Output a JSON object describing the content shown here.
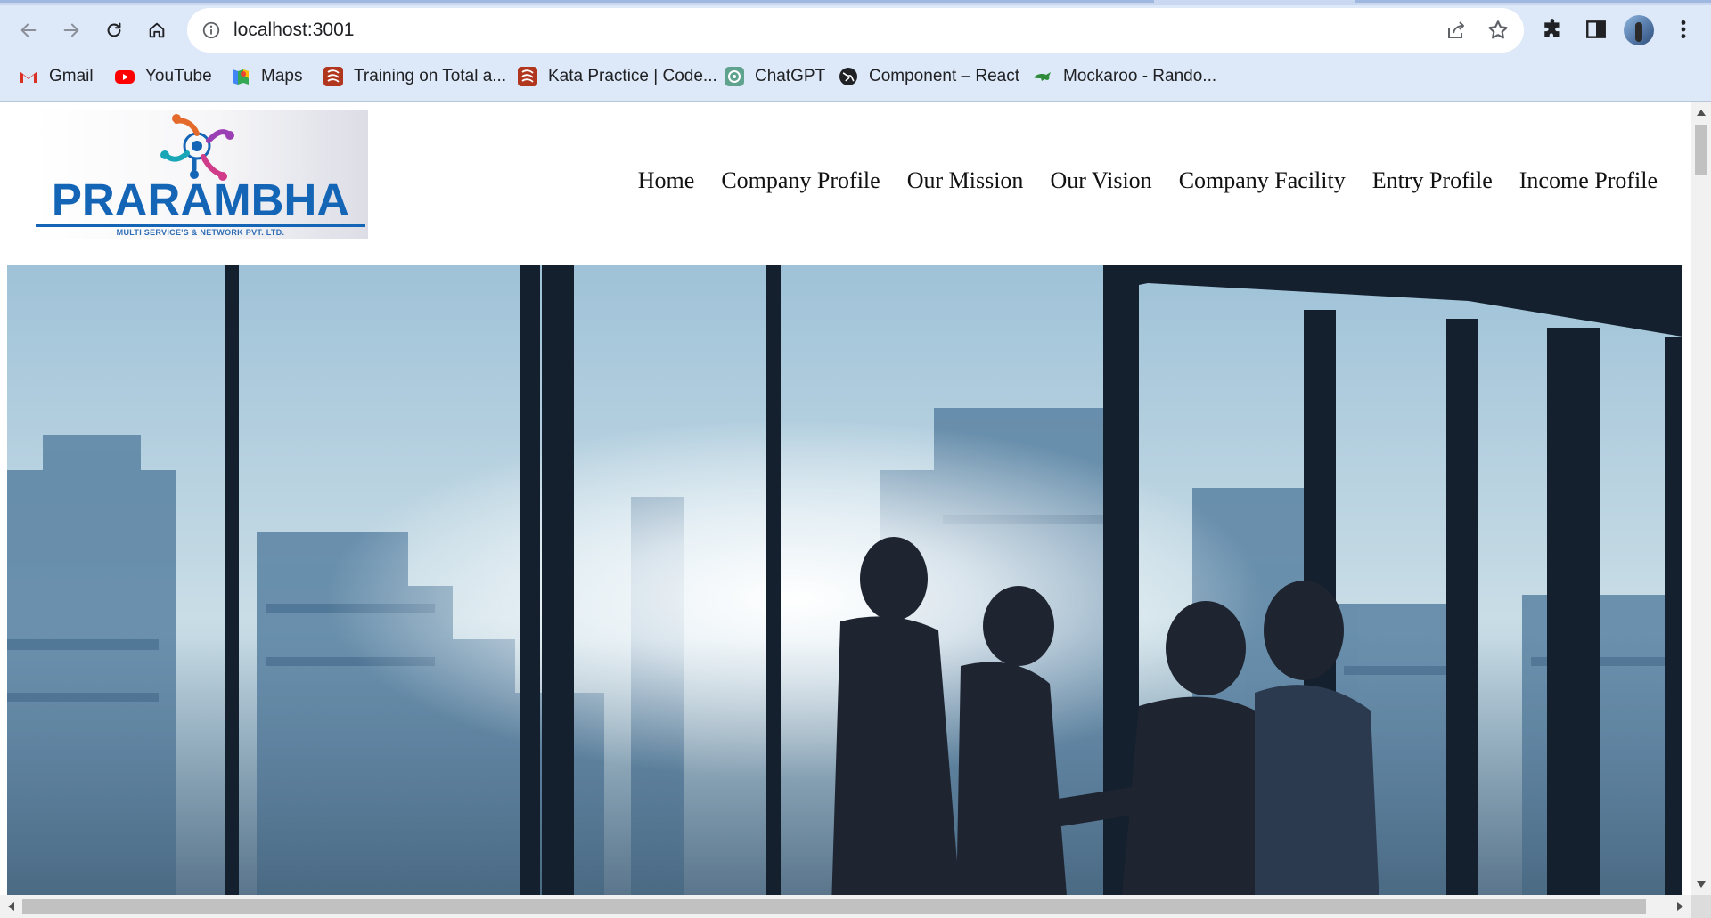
{
  "browser": {
    "url": "localhost:3001",
    "bookmarks": [
      {
        "label": "Gmail",
        "icon": "gmail-icon"
      },
      {
        "label": "YouTube",
        "icon": "youtube-icon"
      },
      {
        "label": "Maps",
        "icon": "maps-icon"
      },
      {
        "label": "Training on Total a...",
        "icon": "codewars-icon"
      },
      {
        "label": "Kata Practice | Code...",
        "icon": "codewars-icon"
      },
      {
        "label": "ChatGPT",
        "icon": "chatgpt-icon"
      },
      {
        "label": "Component – React",
        "icon": "globe-icon"
      },
      {
        "label": "Mockaroo - Rando...",
        "icon": "mockaroo-icon"
      }
    ],
    "colors": {
      "chrome": "#dde8f8",
      "omnibox": "#ffffff"
    }
  },
  "site": {
    "logo": {
      "brand": "PRARAMBHA",
      "tagline": "MULTI SERVICE'S & NETWORK PVT. LTD.",
      "brand_color": "#1565b6"
    },
    "nav": [
      {
        "label": "Home"
      },
      {
        "label": "Company Profile"
      },
      {
        "label": "Our Mission"
      },
      {
        "label": "Our Vision"
      },
      {
        "label": "Company Facility"
      },
      {
        "label": "Entry Profile"
      },
      {
        "label": "Income Profile"
      }
    ],
    "hero": {
      "icon": "business-meeting-silhouette-photo"
    }
  }
}
